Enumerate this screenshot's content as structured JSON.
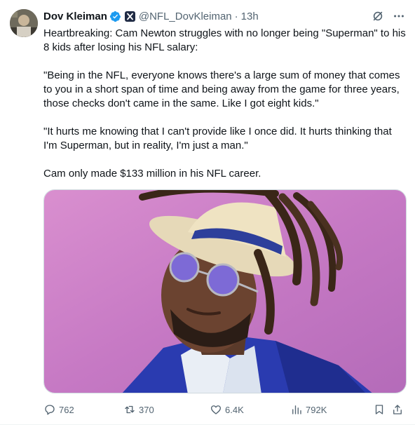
{
  "author": {
    "name": "Dov Kleiman",
    "handle": "@NFL_DovKleiman",
    "separator": "·",
    "time": "13h"
  },
  "tweet": {
    "paragraphs": [
      "Heartbreaking: Cam Newton struggles with no longer being \"Superman\" to his 8 kids after losing his NFL salary:",
      "\"Being in the NFL, everyone knows there's a large sum of money that comes to you in a short span of time and being away from the game for three years, those checks don't came in the same. Like I got eight kids.\"",
      "\"It hurts me knowing that I can't provide like I once did. It hurts thinking that I'm Superman, but in reality, I'm just a man.\"",
      "Cam only made $133 million in his NFL career."
    ]
  },
  "actions": {
    "replies": "762",
    "reposts": "370",
    "likes": "6.4K",
    "views": "792K"
  },
  "icons": {
    "verified": "verified-badge-icon",
    "affiliate": "affiliate-x-icon",
    "grok": "grok-icon",
    "more": "more-icon",
    "reply": "reply-icon",
    "repost": "repost-icon",
    "like": "like-icon",
    "views": "views-icon",
    "bookmark": "bookmark-icon",
    "share": "share-icon"
  },
  "colors": {
    "text": "#0f1419",
    "secondary": "#536471",
    "verified": "#1d9bf0",
    "photo_background": "#c77fbf"
  }
}
